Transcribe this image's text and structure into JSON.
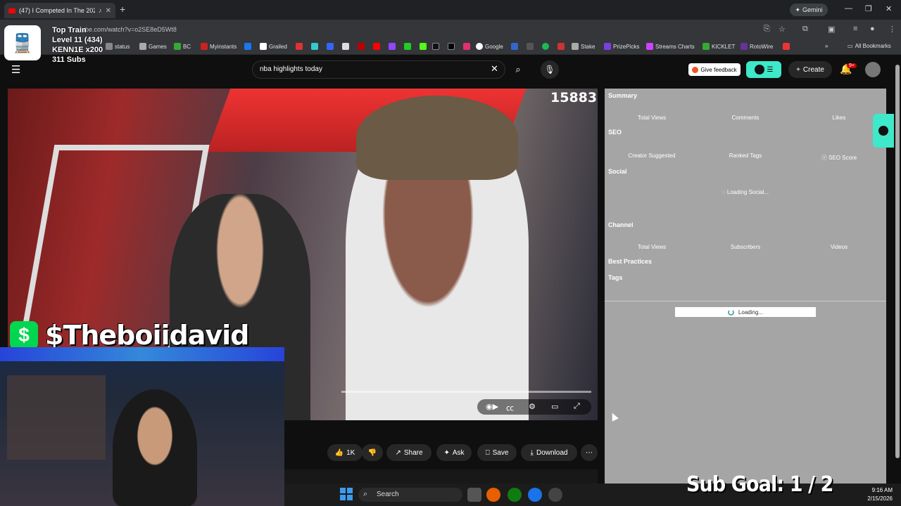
{
  "browser": {
    "tab_title": "(47) I Competed In The 202",
    "url": "ube.com/watch?v=o2SE8eD5Wt8",
    "gemini_label": "Gemini",
    "bookmarks": [
      "status",
      "Games",
      "BC",
      "Myinstants",
      "Grailed",
      "Google",
      "Stake",
      "PrizePicks",
      "Streams Charts",
      "KICKLET",
      "RotoWire"
    ],
    "all_bookmarks": "All Bookmarks"
  },
  "stream_overlay": {
    "top_train": "Top Train",
    "level": "Level 11  (434)",
    "user": "KENN1E x200",
    "subs": "311 Subs",
    "cashtag": "$Theboiidavid",
    "sub_goal": "Sub Goal:  1 / 2"
  },
  "youtube": {
    "search_query": "nba highlights today",
    "feedback": "Give feedback",
    "create": "Create",
    "notif_badge": "9+",
    "view_counter": "15883",
    "actions": {
      "like": "1K",
      "share": "Share",
      "ask": "Ask",
      "save": "Save",
      "download": "Download"
    }
  },
  "vidiq_panel": {
    "summary": "Summary",
    "summary_labels": [
      "Total Views",
      "Comments",
      "Likes"
    ],
    "seo": "SEO",
    "seo_labels": [
      "Creator Suggested",
      "Ranked Tags",
      "SEO Score"
    ],
    "social": "Social",
    "social_loading": "Loading Social...",
    "channel": "Channel",
    "channel_labels": [
      "Total Views",
      "Subscribers",
      "Videos"
    ],
    "best_practices": "Best Practices",
    "tags": "Tags",
    "loading": "Loading..."
  },
  "taskbar": {
    "search": "Search",
    "time": "9:16 AM",
    "date": "2/15/2026"
  }
}
